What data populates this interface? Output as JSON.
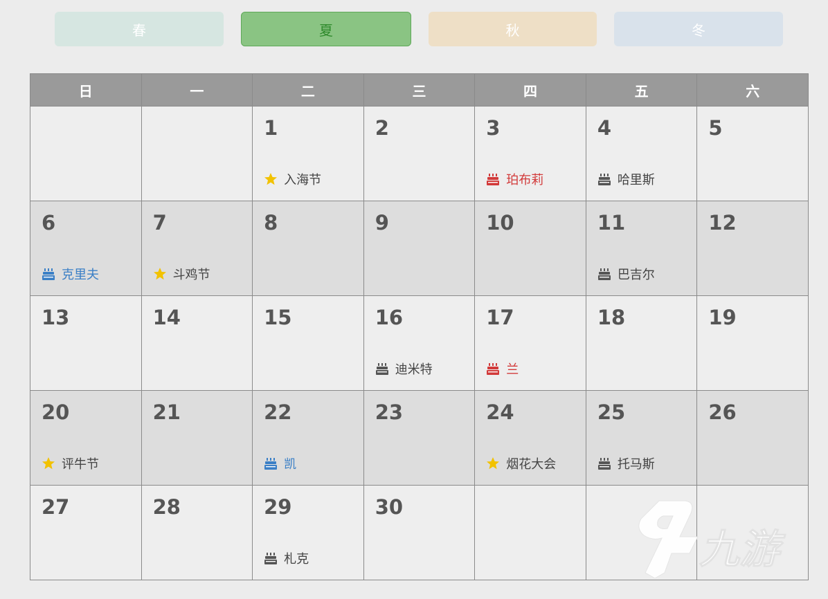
{
  "seasons": [
    {
      "label": "春"
    },
    {
      "label": "夏"
    },
    {
      "label": "秋"
    },
    {
      "label": "冬"
    }
  ],
  "selected_season": "夏",
  "weekdays": [
    "日",
    "一",
    "二",
    "三",
    "四",
    "五",
    "六"
  ],
  "weeks": [
    [
      null,
      null,
      {
        "day": "1",
        "event": {
          "text": "入海节",
          "icon": "star-icon",
          "color": "default"
        }
      },
      {
        "day": "2"
      },
      {
        "day": "3",
        "event": {
          "text": "珀布莉",
          "icon": "cake-icon",
          "color": "red"
        }
      },
      {
        "day": "4",
        "event": {
          "text": "哈里斯",
          "icon": "cake-icon",
          "color": "default"
        }
      },
      {
        "day": "5"
      }
    ],
    [
      {
        "day": "6",
        "event": {
          "text": "克里夫",
          "icon": "cake-icon",
          "color": "blue"
        }
      },
      {
        "day": "7",
        "event": {
          "text": "斗鸡节",
          "icon": "star-icon",
          "color": "default"
        }
      },
      {
        "day": "8"
      },
      {
        "day": "9"
      },
      {
        "day": "10"
      },
      {
        "day": "11",
        "event": {
          "text": "巴吉尔",
          "icon": "cake-icon",
          "color": "default"
        }
      },
      {
        "day": "12"
      }
    ],
    [
      {
        "day": "13"
      },
      {
        "day": "14"
      },
      {
        "day": "15"
      },
      {
        "day": "16",
        "event": {
          "text": "迪米特",
          "icon": "cake-icon",
          "color": "default"
        }
      },
      {
        "day": "17",
        "event": {
          "text": "兰",
          "icon": "cake-icon",
          "color": "red"
        }
      },
      {
        "day": "18"
      },
      {
        "day": "19"
      }
    ],
    [
      {
        "day": "20",
        "event": {
          "text": "评牛节",
          "icon": "star-icon",
          "color": "default"
        }
      },
      {
        "day": "21"
      },
      {
        "day": "22",
        "event": {
          "text": "凯",
          "icon": "cake-icon",
          "color": "blue"
        }
      },
      {
        "day": "23"
      },
      {
        "day": "24",
        "event": {
          "text": "烟花大会",
          "icon": "star-icon",
          "color": "default"
        }
      },
      {
        "day": "25",
        "event": {
          "text": "托马斯",
          "icon": "cake-icon",
          "color": "default"
        }
      },
      {
        "day": "26"
      }
    ],
    [
      {
        "day": "27"
      },
      {
        "day": "28"
      },
      {
        "day": "29",
        "event": {
          "text": "札克",
          "icon": "cake-icon",
          "color": "default"
        }
      },
      {
        "day": "30"
      },
      null,
      null,
      null
    ]
  ],
  "colors": {
    "star": "#f2c200",
    "cake_default": "#555555",
    "cake_red": "#d23a3a",
    "cake_blue": "#3a7fc6"
  },
  "watermark": {
    "text": "九游",
    "icon": "jiuyou-logo-icon"
  }
}
